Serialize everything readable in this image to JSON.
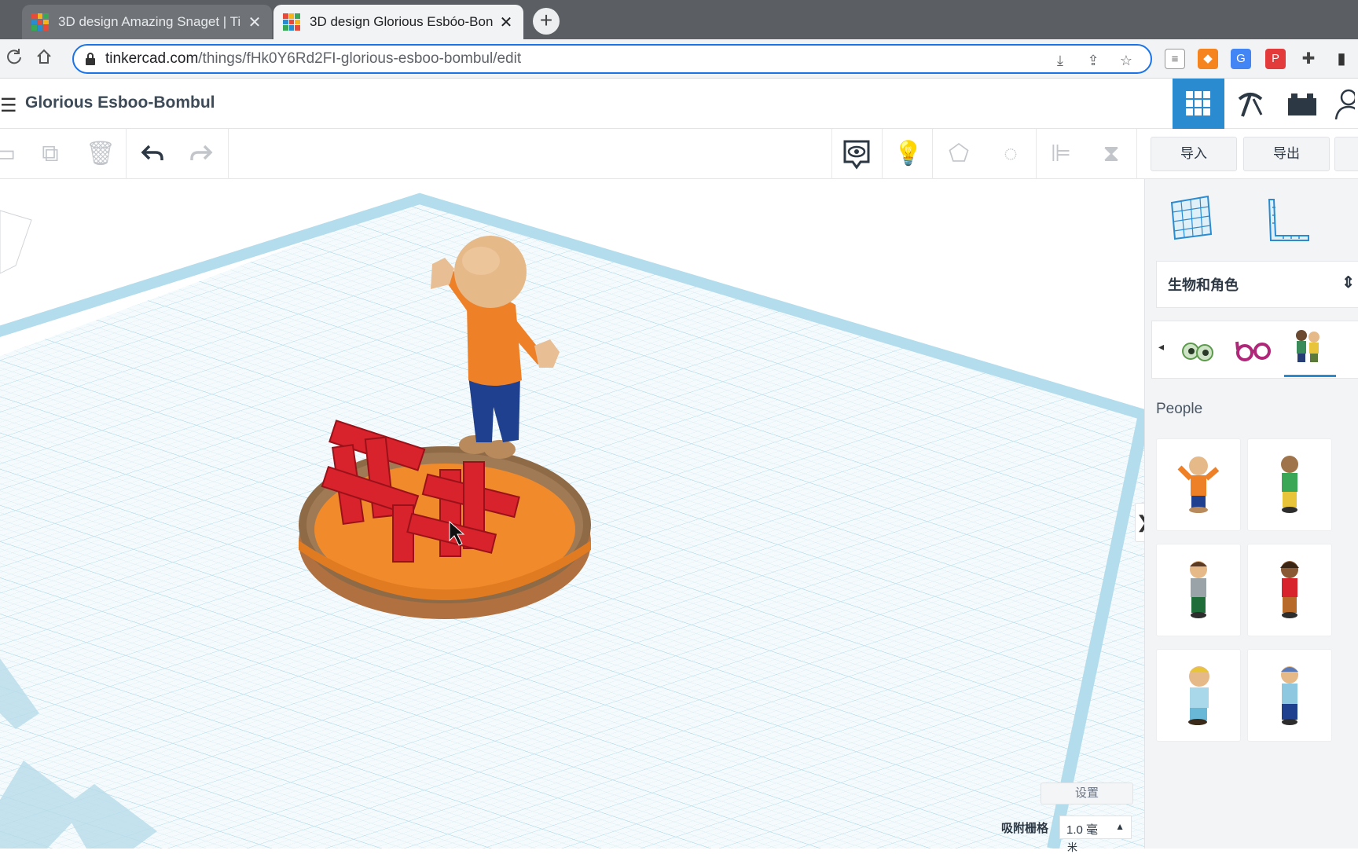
{
  "browser": {
    "tabs": [
      {
        "title": "3D design Amazing Snaget | Ti",
        "close": "✕"
      },
      {
        "title": "3D design Glorious Esbóo-Bon",
        "close": "✕"
      }
    ],
    "new_tab": "+",
    "url_host": "tinkercad.com",
    "url_path": "/things/fHk0Y6Rd2FI-glorious-esboo-bombul/edit"
  },
  "app": {
    "design_name": "Glorious Esboo-Bombul",
    "toolbar": {
      "import_label": "导入",
      "export_label": "导出"
    },
    "panel": {
      "library_selected": "生物和角色",
      "section_title": "People"
    },
    "footer": {
      "settings_label": "设置",
      "snap_label": "吸附栅格",
      "snap_value": "1.0 毫",
      "snap_unit_cut": "米"
    },
    "colors": {
      "accent": "#2a8bd1",
      "grid": "#cde7f2",
      "base_orange": "#f08a2a",
      "text_red": "#d8222c"
    }
  }
}
